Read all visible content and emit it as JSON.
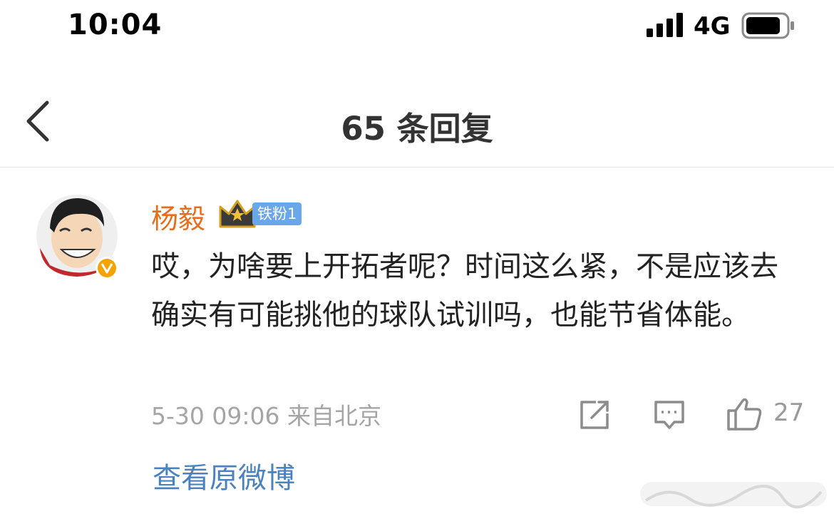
{
  "status_bar": {
    "time": "10:04",
    "network": "4G"
  },
  "nav": {
    "title": "65 条回复"
  },
  "comment": {
    "username": "杨毅",
    "fan_badge": "铁粉1",
    "text": "哎，为啥要上开拓者呢？时间这么紧，不是应该去确实有可能挑他的球队试训吗，也能节省体能。",
    "meta": "5-30 09:06  来自北京",
    "like_count": "27"
  },
  "footer": {
    "view_original": "查看原微博"
  },
  "colors": {
    "username": "#e96c1b",
    "fan_badge_bg": "#6aa7ea",
    "link": "#4a82c0",
    "meta": "#a5a5a5",
    "verified_badge": "#f5a300"
  },
  "icons": [
    "back-icon",
    "share-icon",
    "comment-icon",
    "like-icon",
    "crown-icon",
    "verified-v-icon",
    "signal-icon",
    "battery-icon"
  ]
}
